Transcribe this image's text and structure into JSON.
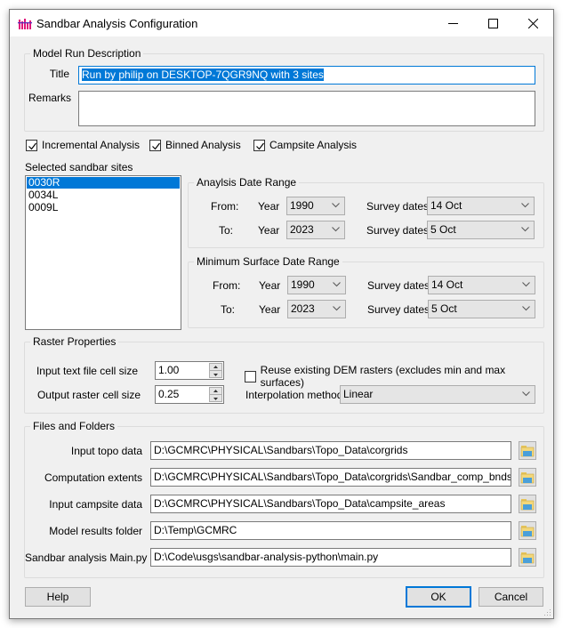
{
  "window": {
    "title": "Sandbar Analysis Configuration",
    "app_icon": "bar-chart-icon",
    "controls": [
      "minimize-icon",
      "maximize-icon",
      "close-icon"
    ]
  },
  "model_run": {
    "group_label": "Model Run Description",
    "title_label": "Title",
    "title_value": "Run by philip on DESKTOP-7QGR9NQ with 3 sites",
    "remarks_label": "Remarks",
    "remarks_value": ""
  },
  "analysis_options": [
    {
      "label": "Incremental Analysis",
      "checked": true
    },
    {
      "label": "Binned Analysis",
      "checked": true
    },
    {
      "label": "Campsite Analysis",
      "checked": true
    }
  ],
  "sites": {
    "label": "Selected sandbar sites",
    "items": [
      "0030R",
      "0034L",
      "0009L"
    ],
    "selected": "0030R"
  },
  "analysis_date_range": {
    "group_label": "Anaylsis Date Range",
    "from_label": "From:",
    "to_label": "To:",
    "year_label": "Year",
    "survey_label": "Survey dates",
    "from_year": "1990",
    "from_survey": "14 Oct",
    "to_year": "2023",
    "to_survey": "5 Oct"
  },
  "min_surface_date_range": {
    "group_label": "Minimum Surface Date Range",
    "from_label": "From:",
    "to_label": "To:",
    "year_label": "Year",
    "survey_label": "Survey dates",
    "from_year": "1990",
    "from_survey": "14 Oct",
    "to_year": "2023",
    "to_survey": "5 Oct"
  },
  "raster": {
    "group_label": "Raster Properties",
    "input_cell_label": "Input text file cell size",
    "input_cell_value": "1.00",
    "output_cell_label": "Output raster cell size",
    "output_cell_value": "0.25",
    "reuse_label": "Reuse existing DEM rasters (excludes min and max surfaces)",
    "reuse_checked": false,
    "interp_label": "Interpolation method",
    "interp_value": "Linear"
  },
  "files": {
    "group_label": "Files and Folders",
    "rows": [
      {
        "label": "Input topo data",
        "value": "D:\\GCMRC\\PHYSICAL\\Sandbars\\Topo_Data\\corgrids"
      },
      {
        "label": "Computation extents",
        "value": "D:\\GCMRC\\PHYSICAL\\Sandbars\\Topo_Data\\corgrids\\Sandbar_comp_bnds\\Comp"
      },
      {
        "label": "Input campsite data",
        "value": "D:\\GCMRC\\PHYSICAL\\Sandbars\\Topo_Data\\campsite_areas"
      },
      {
        "label": "Model results folder",
        "value": "D:\\Temp\\GCMRC"
      },
      {
        "label": "Sandbar analysis Main.py",
        "value": "D:\\Code\\usgs\\sandbar-analysis-python\\main.py"
      }
    ]
  },
  "buttons": {
    "help": "Help",
    "ok": "OK",
    "cancel": "Cancel"
  },
  "colors": {
    "accent": "#0078d7",
    "dialog_bg": "#f0f0f0"
  }
}
